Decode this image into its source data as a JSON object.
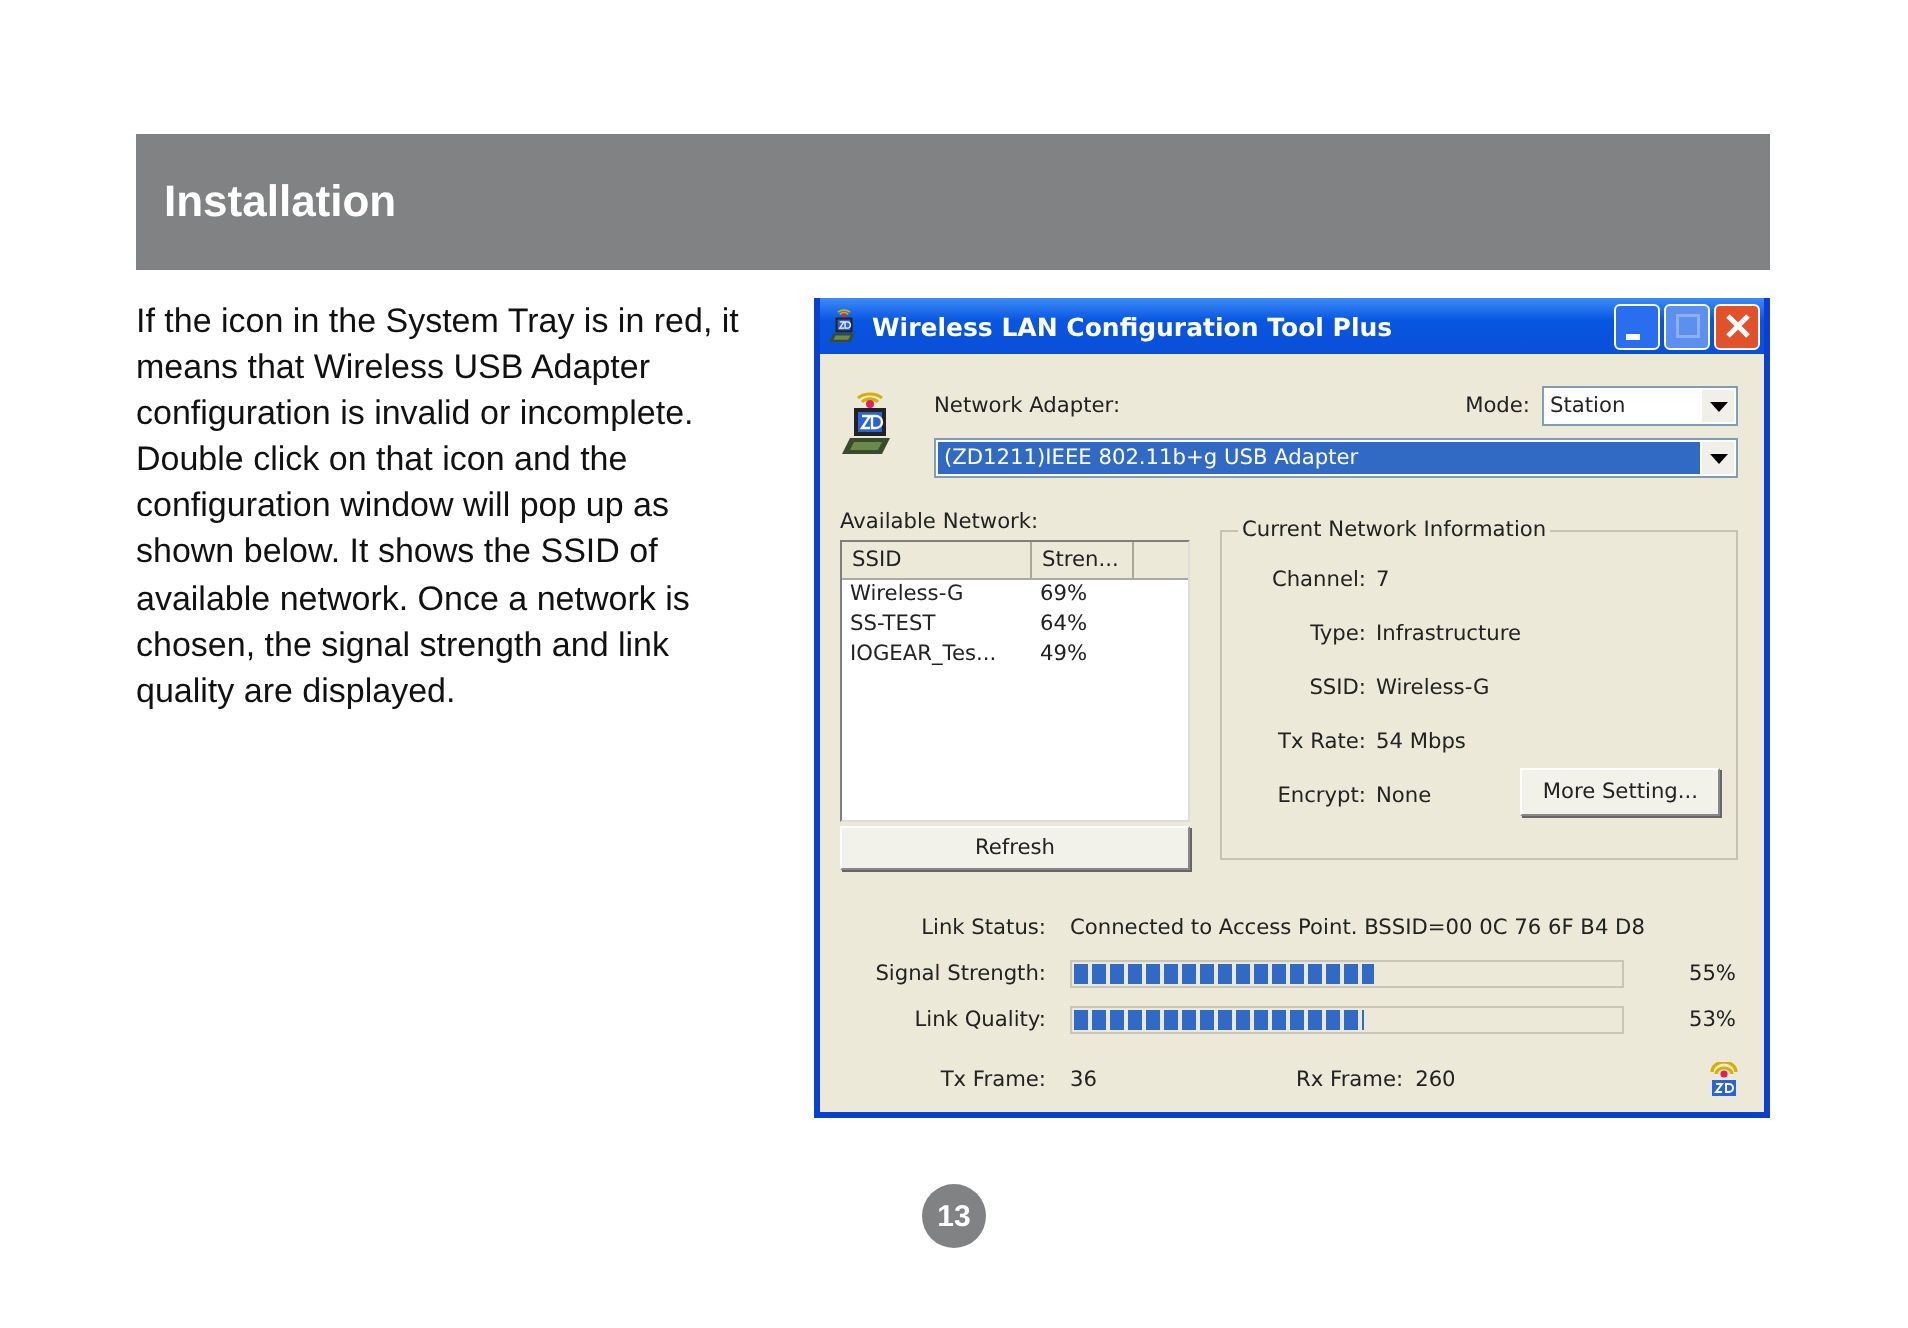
{
  "header": {
    "title": "Installation"
  },
  "body_text": "If the icon in the System Tray is in red, it means that Wireless USB Adapter configuration is invalid or incomplete. Double click on that icon and the configuration window will pop up as shown below. It shows the SSID of available network. Once a network is chosen, the signal strength and link quality are displayed.",
  "window": {
    "title": "Wireless LAN Configuration Tool Plus"
  },
  "adapter": {
    "label": "Network Adapter:",
    "value": "(ZD1211)IEEE 802.11b+g USB Adapter"
  },
  "mode": {
    "label": "Mode:",
    "value": "Station"
  },
  "available": {
    "label": "Available Network:",
    "columns": [
      "SSID",
      "Stren..."
    ],
    "rows": [
      {
        "ssid": "Wireless-G",
        "strength": "69%"
      },
      {
        "ssid": "SS-TEST",
        "strength": "64%"
      },
      {
        "ssid": "IOGEAR_Tes...",
        "strength": "49%"
      }
    ],
    "refresh_button": "Refresh"
  },
  "current": {
    "title": "Current Network Information",
    "fields": [
      {
        "label": "Channel:",
        "value": "7"
      },
      {
        "label": "Type:",
        "value": "Infrastructure"
      },
      {
        "label": "SSID:",
        "value": "Wireless-G"
      },
      {
        "label": "Tx Rate:",
        "value": "54 Mbps"
      },
      {
        "label": "Encrypt:",
        "value": "None"
      }
    ],
    "more_button": "More Setting..."
  },
  "link_status": {
    "label": "Link Status:",
    "value": "Connected to Access Point. BSSID=00 0C 76 6F B4 D8"
  },
  "meters": [
    {
      "label": "Signal Strength:",
      "level": 0.55,
      "reading": "55%"
    },
    {
      "label": "Link Quality:",
      "level": 0.53,
      "reading": "53%"
    }
  ],
  "frames": {
    "tx_label": "Tx Frame:",
    "tx_value": "36",
    "rx_label": "Rx Frame:",
    "rx_value": "260"
  },
  "page_number": "13"
}
